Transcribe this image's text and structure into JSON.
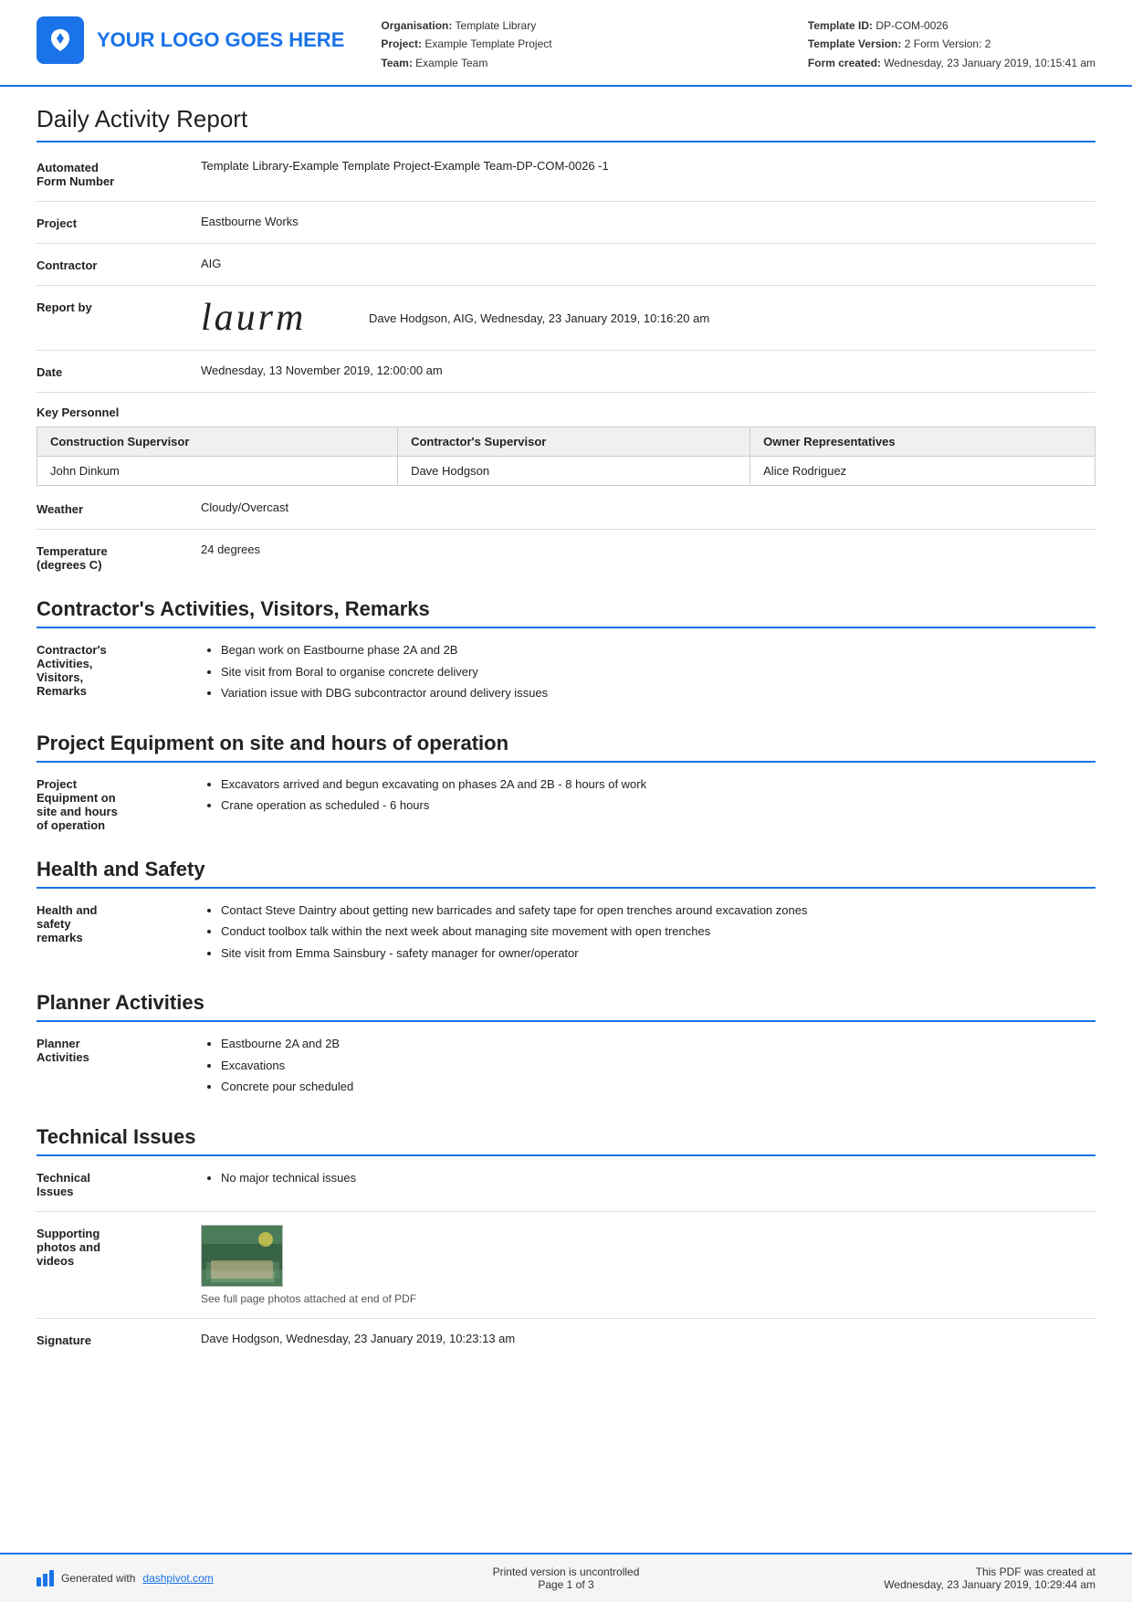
{
  "header": {
    "logo_text": "YOUR LOGO GOES HERE",
    "org_label": "Organisation:",
    "org_value": "Template Library",
    "project_label": "Project:",
    "project_value": "Example Template Project",
    "team_label": "Team:",
    "team_value": "Example Team",
    "template_id_label": "Template ID:",
    "template_id_value": "DP-COM-0026",
    "template_version_label": "Template Version:",
    "template_version_value": "2 Form Version: 2",
    "form_created_label": "Form created:",
    "form_created_value": "Wednesday, 23 January 2019, 10:15:41 am"
  },
  "report": {
    "title": "Daily Activity Report",
    "automated_form_label": "Automated\nForm Number",
    "automated_form_value": "Template Library-Example Template Project-Example Team-DP-COM-0026   -1",
    "project_label": "Project",
    "project_value": "Eastbourne Works",
    "contractor_label": "Contractor",
    "contractor_value": "AIG",
    "report_by_label": "Report by",
    "report_by_value": "Dave Hodgson, AIG, Wednesday, 23 January 2019, 10:16:20 am",
    "date_label": "Date",
    "date_value": "Wednesday, 13 November 2019, 12:00:00 am"
  },
  "personnel": {
    "section_label": "Key Personnel",
    "col1": "Construction Supervisor",
    "col2": "Contractor's Supervisor",
    "col3": "Owner Representatives",
    "row1_col1": "John Dinkum",
    "row1_col2": "Dave Hodgson",
    "row1_col3": "Alice Rodriguez"
  },
  "weather": {
    "label": "Weather",
    "value": "Cloudy/Overcast"
  },
  "temperature": {
    "label": "Temperature\n(degrees C)",
    "value": "24 degrees"
  },
  "contractors_activities": {
    "section_title": "Contractor's Activities, Visitors, Remarks",
    "field_label": "Contractor's\nActivities,\nVisitors,\nRemarks",
    "items": [
      "Began work on Eastbourne phase 2A and 2B",
      "Site visit from Boral to organise concrete delivery",
      "Variation issue with DBG subcontractor around delivery issues"
    ]
  },
  "equipment": {
    "section_title": "Project Equipment on site and hours of operation",
    "field_label": "Project\nEquipment on\nsite and hours\nof operation",
    "items": [
      "Excavators arrived and begun excavating on phases 2A and 2B - 8 hours of work",
      "Crane operation as scheduled - 6 hours"
    ]
  },
  "health_safety": {
    "section_title": "Health and Safety",
    "field_label": "Health and\nsafety\nremarks",
    "items": [
      "Contact Steve Daintry about getting new barricades and safety tape for open trenches around excavation zones",
      "Conduct toolbox talk within the next week about managing site movement with open trenches",
      "Site visit from Emma Sainsbury - safety manager for owner/operator"
    ]
  },
  "planner": {
    "section_title": "Planner Activities",
    "field_label": "Planner\nActivities",
    "items": [
      "Eastbourne 2A and 2B",
      "Excavations",
      "Concrete pour scheduled"
    ]
  },
  "technical": {
    "section_title": "Technical Issues",
    "field_label": "Technical\nIssues",
    "items": [
      "No major technical issues"
    ],
    "photos_label": "Supporting\nphotos and\nvideos",
    "photos_caption": "See full page photos attached at end of PDF"
  },
  "signature": {
    "label": "Signature",
    "value": "Dave Hodgson, Wednesday, 23 January 2019, 10:23:13 am"
  },
  "footer": {
    "generated_text": "Generated with ",
    "link_text": "dashpivot.com",
    "center_text": "Printed version is uncontrolled",
    "page_text": "Page 1 of 3",
    "right_text": "This PDF was created at\nWednesday, 23 January 2019, 10:29:44 am"
  }
}
